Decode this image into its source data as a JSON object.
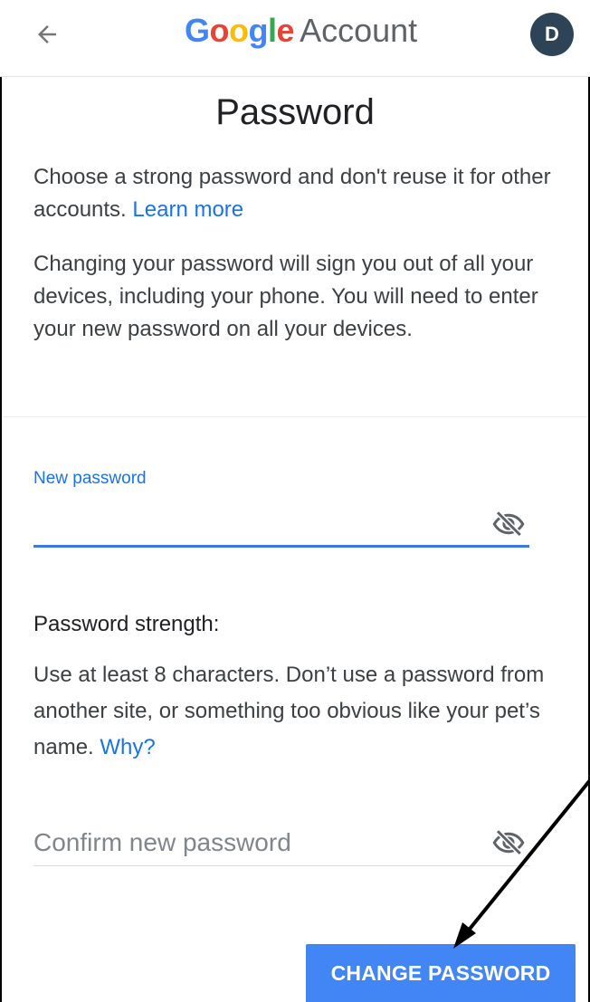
{
  "header": {
    "back_icon": "arrow-left-icon",
    "brand_letters": [
      {
        "char": "G",
        "color": "#4285F4"
      },
      {
        "char": "o",
        "color": "#EA4335"
      },
      {
        "char": "o",
        "color": "#FBBC05"
      },
      {
        "char": "g",
        "color": "#4285F4"
      },
      {
        "char": "l",
        "color": "#34A853"
      },
      {
        "char": "e",
        "color": "#EA4335"
      }
    ],
    "brand_suffix": "Account",
    "avatar_initial": "D"
  },
  "page": {
    "title": "Password",
    "intro_text": "Choose a strong password and don't reuse it for other accounts.",
    "learn_more_link": "Learn more",
    "warning_text": "Changing your password will sign you out of all your devices, including your phone. You will need to enter your new password on all your devices."
  },
  "new_password": {
    "label": "New password",
    "value": "",
    "visibility_icon": "eye-off-icon"
  },
  "strength": {
    "label": "Password strength:",
    "hint_text": "Use at least 8 characters. Don’t use a password from another site, or something too obvious like your pet’s name.",
    "why_link": "Why?"
  },
  "confirm_password": {
    "placeholder": "Confirm new password",
    "value": "",
    "visibility_icon": "eye-off-icon"
  },
  "actions": {
    "change_password_label": "CHANGE PASSWORD"
  },
  "colors": {
    "accent": "#1a73e8",
    "button": "#4285f4",
    "avatar_bg": "#2d4356",
    "annotation_arrow": "#000000"
  }
}
